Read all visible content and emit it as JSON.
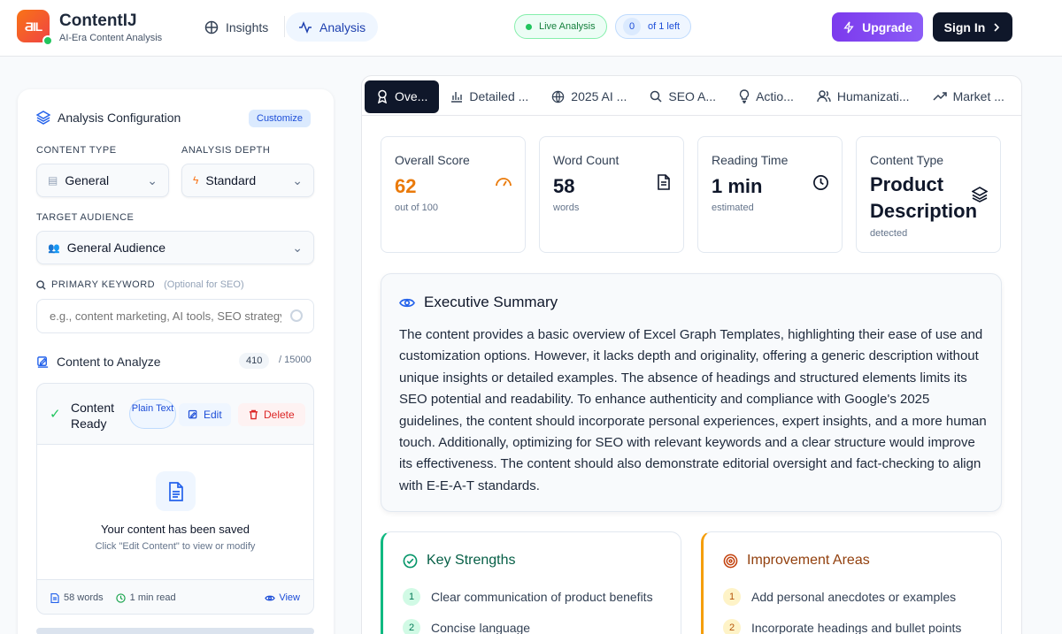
{
  "app": {
    "name": "ContentIJ",
    "tagline": "AI-Era Content Analysis",
    "logo_text": "ƋIL"
  },
  "nav": {
    "insights": "Insights",
    "analysis": "Analysis"
  },
  "header": {
    "live": "Live Analysis",
    "quota_num": "0",
    "quota_text": "of 1 left",
    "upgrade": "Upgrade",
    "signin": "Sign In"
  },
  "config": {
    "title": "Analysis Configuration",
    "customize": "Customize",
    "content_type_label": "CONTENT TYPE",
    "content_type_value": "General",
    "depth_label": "ANALYSIS DEPTH",
    "depth_value": "Standard",
    "audience_label": "TARGET AUDIENCE",
    "audience_value": "General Audience",
    "keyword_label": "PRIMARY KEYWORD",
    "keyword_optional": "(Optional for SEO)",
    "keyword_placeholder": "e.g., content marketing, AI tools, SEO strategy",
    "content_label": "Content to Analyze",
    "char_count": "410",
    "char_max": "/ 15000"
  },
  "content_box": {
    "status": "Content Ready",
    "format": "Plain Text",
    "edit": "Edit",
    "delete": "Delete",
    "saved_title": "Your content has been saved",
    "saved_sub": "Click \"Edit Content\" to view or modify",
    "words": "58 words",
    "read": "1 min read",
    "view": "View"
  },
  "tabs": [
    {
      "label": "Ove...",
      "icon": "award-icon"
    },
    {
      "label": "Detailed ...",
      "icon": "bar-chart-icon"
    },
    {
      "label": "2025 AI ...",
      "icon": "globe-icon"
    },
    {
      "label": "SEO A...",
      "icon": "search-icon"
    },
    {
      "label": "Actio...",
      "icon": "lightbulb-icon"
    },
    {
      "label": "Humanizati...",
      "icon": "users-icon"
    },
    {
      "label": "Market ...",
      "icon": "trending-up-icon"
    }
  ],
  "stats": {
    "score": {
      "label": "Overall Score",
      "value": "62",
      "sub": "out of 100",
      "color": "#ea7a0a"
    },
    "words": {
      "label": "Word Count",
      "value": "58",
      "sub": "words"
    },
    "reading": {
      "label": "Reading Time",
      "value": "1 min",
      "sub": "estimated"
    },
    "type": {
      "label": "Content Type",
      "value": "Product Description",
      "sub": "detected"
    }
  },
  "summary": {
    "title": "Executive Summary",
    "text": "The content provides a basic overview of Excel Graph Templates, highlighting their ease of use and customization options. However, it lacks depth and originality, offering a generic description without unique insights or detailed examples. The absence of headings and structured elements limits its SEO potential and readability. To enhance authenticity and compliance with Google's 2025 guidelines, the content should incorporate personal experiences, expert insights, and a more human touch. Additionally, optimizing for SEO with relevant keywords and a clear structure would improve its effectiveness. The content should also demonstrate editorial oversight and fact-checking to align with E-E-A-T standards."
  },
  "strengths": {
    "title": "Key Strengths",
    "items": [
      {
        "n": "1",
        "text": "Clear communication of product benefits"
      },
      {
        "n": "2",
        "text": "Concise language"
      }
    ]
  },
  "improvements": {
    "title": "Improvement Areas",
    "items": [
      {
        "n": "1",
        "text": "Add personal anecdotes or examples"
      },
      {
        "n": "2",
        "text": "Incorporate headings and bullet points"
      }
    ]
  }
}
